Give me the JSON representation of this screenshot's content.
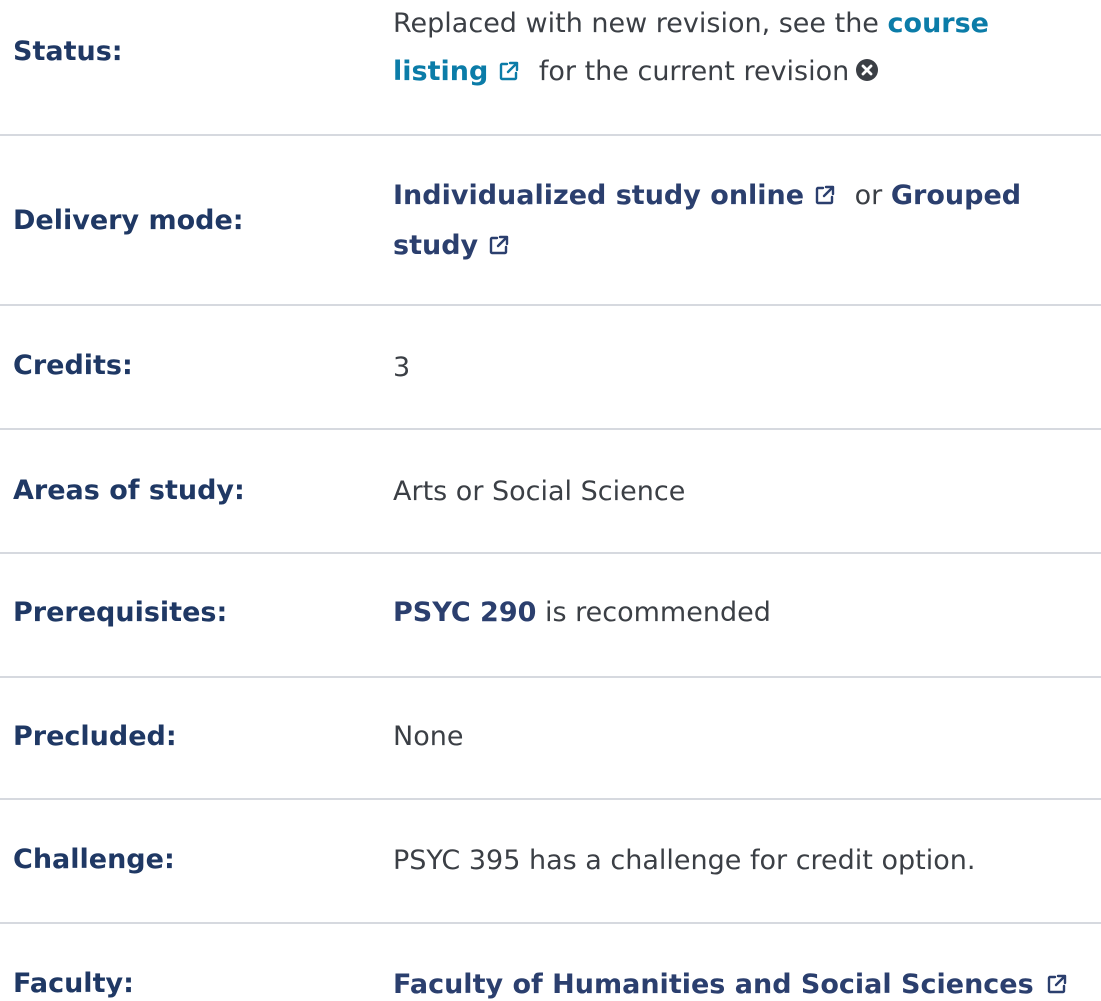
{
  "rows": [
    {
      "label": "Status:",
      "text_before": "Replaced with new revision, see the ",
      "link": "course listing",
      "text_after": " for the current revision"
    },
    {
      "label": "Delivery mode:",
      "link1": "Individualized study online",
      "or": " or ",
      "link2": "Grouped study"
    },
    {
      "label": "Credits:",
      "value": "3"
    },
    {
      "label": "Areas of study:",
      "value": "Arts or Social Science"
    },
    {
      "label": "Prerequisites:",
      "link": "PSYC 290",
      "text_after": " is recommended"
    },
    {
      "label": "Precluded:",
      "value": "None"
    },
    {
      "label": "Challenge:",
      "value": "PSYC 395 has a challenge for credit option."
    },
    {
      "label": "Faculty:",
      "link": "Faculty of Humanities and Social Sciences"
    }
  ],
  "icons": {
    "external": "external-link-icon",
    "close": "circle-x-icon"
  },
  "colors": {
    "label": "#1f3864",
    "link_teal": "#0b7ca8",
    "link_navy": "#2b3f6e",
    "text": "#3b3f45",
    "divider": "#d6d9df"
  }
}
